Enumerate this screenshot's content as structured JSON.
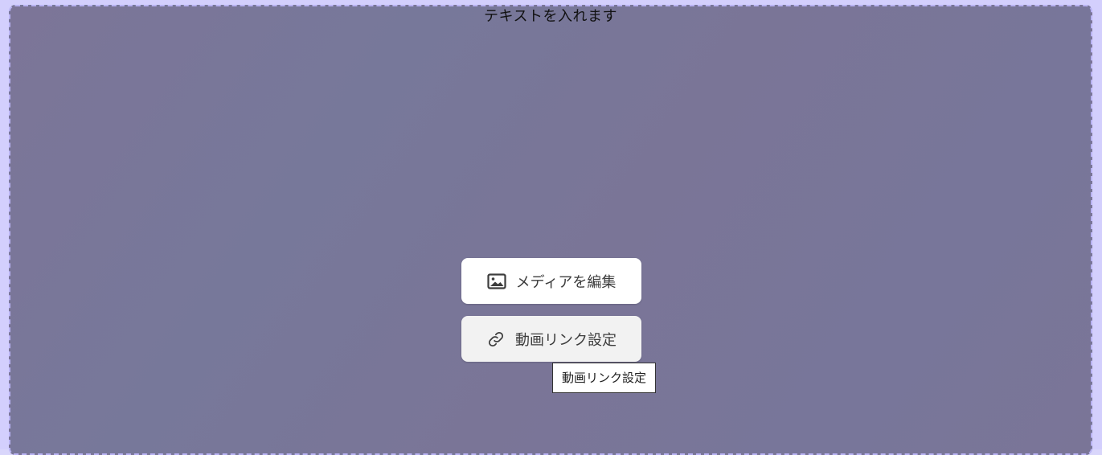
{
  "block": {
    "title": "テキストを入れます"
  },
  "buttons": {
    "edit_media": {
      "label": "メディアを編集",
      "icon": "image-icon"
    },
    "video_link": {
      "label": "動画リンク設定",
      "icon": "link-icon"
    }
  },
  "tooltip": {
    "text": "動画リンク設定"
  },
  "colors": {
    "background": "#d3cffd",
    "block_fill": "#7a7698",
    "dashed_border": "#b9b3f3"
  }
}
